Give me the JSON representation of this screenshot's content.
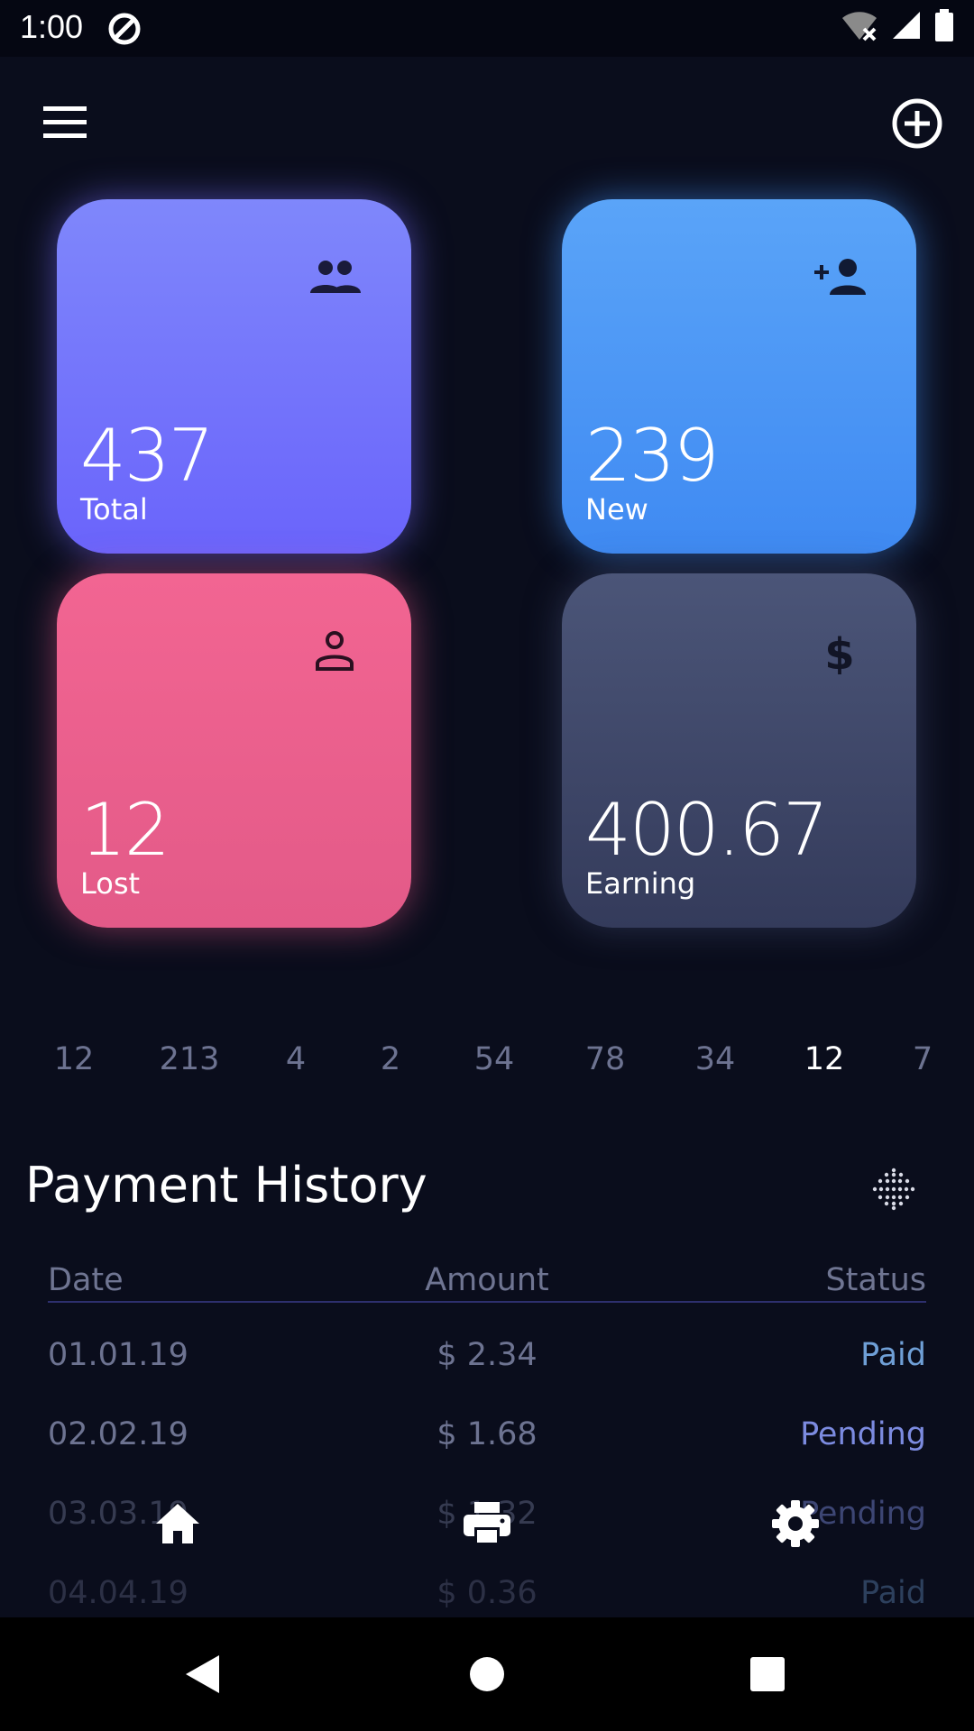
{
  "status_bar": {
    "time": "1:00"
  },
  "cards": [
    {
      "id": "total",
      "value": "437",
      "label": "Total",
      "icon": "group-icon"
    },
    {
      "id": "new",
      "value": "239",
      "label": "New",
      "icon": "person-add-icon"
    },
    {
      "id": "lost",
      "value": "12",
      "label": "Lost",
      "icon": "person-outline-icon"
    },
    {
      "id": "earning",
      "value": "400.67",
      "label": "Earning",
      "icon": "dollar-icon"
    }
  ],
  "number_selector": {
    "items": [
      "12",
      "213",
      "4",
      "2",
      "54",
      "78",
      "34",
      "12",
      "7"
    ],
    "active_index": 7
  },
  "payment_history": {
    "title": "Payment History",
    "headers": {
      "date": "Date",
      "amount": "Amount",
      "status": "Status"
    },
    "rows": [
      {
        "date": "01.01.19",
        "amount": "$ 2.34",
        "status": "Paid"
      },
      {
        "date": "02.02.19",
        "amount": "$ 1.68",
        "status": "Pending"
      },
      {
        "date": "03.03.19",
        "amount": "$ 1.32",
        "status": "Pending"
      },
      {
        "date": "04.04.19",
        "amount": "$ 0.36",
        "status": "Paid"
      }
    ]
  },
  "bottom_nav": {
    "items": [
      "home-icon",
      "print-icon",
      "settings-icon"
    ]
  },
  "colors": {
    "background": "#0a0d1c",
    "total": "#7179fb",
    "new": "#4b97f5",
    "lost": "#ec6190",
    "earning": "#404868",
    "paid": "#6f9fd6",
    "pending": "#7c8be0"
  }
}
